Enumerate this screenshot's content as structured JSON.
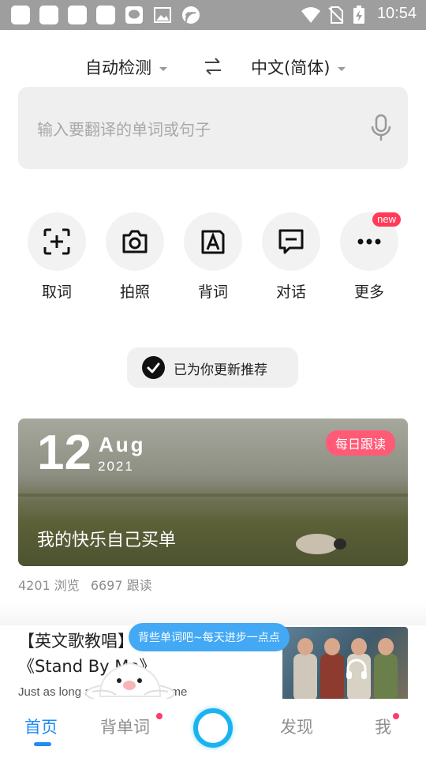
{
  "status_bar": {
    "time": "10:54",
    "icons": [
      "notification-square",
      "notification-square",
      "notification-square",
      "notification-square",
      "message-icon",
      "image-icon",
      "cast-icon",
      "wifi-icon",
      "no-sim-icon",
      "battery-charging-icon"
    ]
  },
  "language": {
    "source": "自动检测",
    "target": "中文(简体)",
    "swap_icon": "swap-icon"
  },
  "search": {
    "placeholder": "输入要翻译的单词或句子",
    "mic_icon": "microphone-icon"
  },
  "features": [
    {
      "label": "取词",
      "icon": "scan-add-icon"
    },
    {
      "label": "拍照",
      "icon": "camera-icon"
    },
    {
      "label": "背词",
      "icon": "letter-card-icon"
    },
    {
      "label": "对话",
      "icon": "chat-icon"
    },
    {
      "label": "更多",
      "icon": "more-icon",
      "badge": "new"
    }
  ],
  "updated_notice": "已为你更新推荐",
  "daily": {
    "day": "12",
    "month": "Aug",
    "year": "2021",
    "badge": "每日跟读",
    "title": "我的快乐自己买单",
    "views": "4201 浏览",
    "follows": "6697 跟读"
  },
  "article": {
    "title": "【英文歌教唱】的温暖单曲《Stand By Me》",
    "subtitle": "Just as long as you stand by me"
  },
  "mascot_tip": "背些单词吧~每天进步一点点",
  "bottom_nav": [
    {
      "label": "首页",
      "active": true
    },
    {
      "label": "背单词",
      "dot": true
    },
    {
      "label": "",
      "icon": "assistant-ring-icon"
    },
    {
      "label": "发现"
    },
    {
      "label": "我",
      "dot": true
    }
  ],
  "colors": {
    "accent": "#1f8cf4",
    "badge_pink": "#ff5b77",
    "new_red": "#ff3b57",
    "tip_blue": "#43a9f5",
    "status_bar": "#9e9e9e"
  }
}
